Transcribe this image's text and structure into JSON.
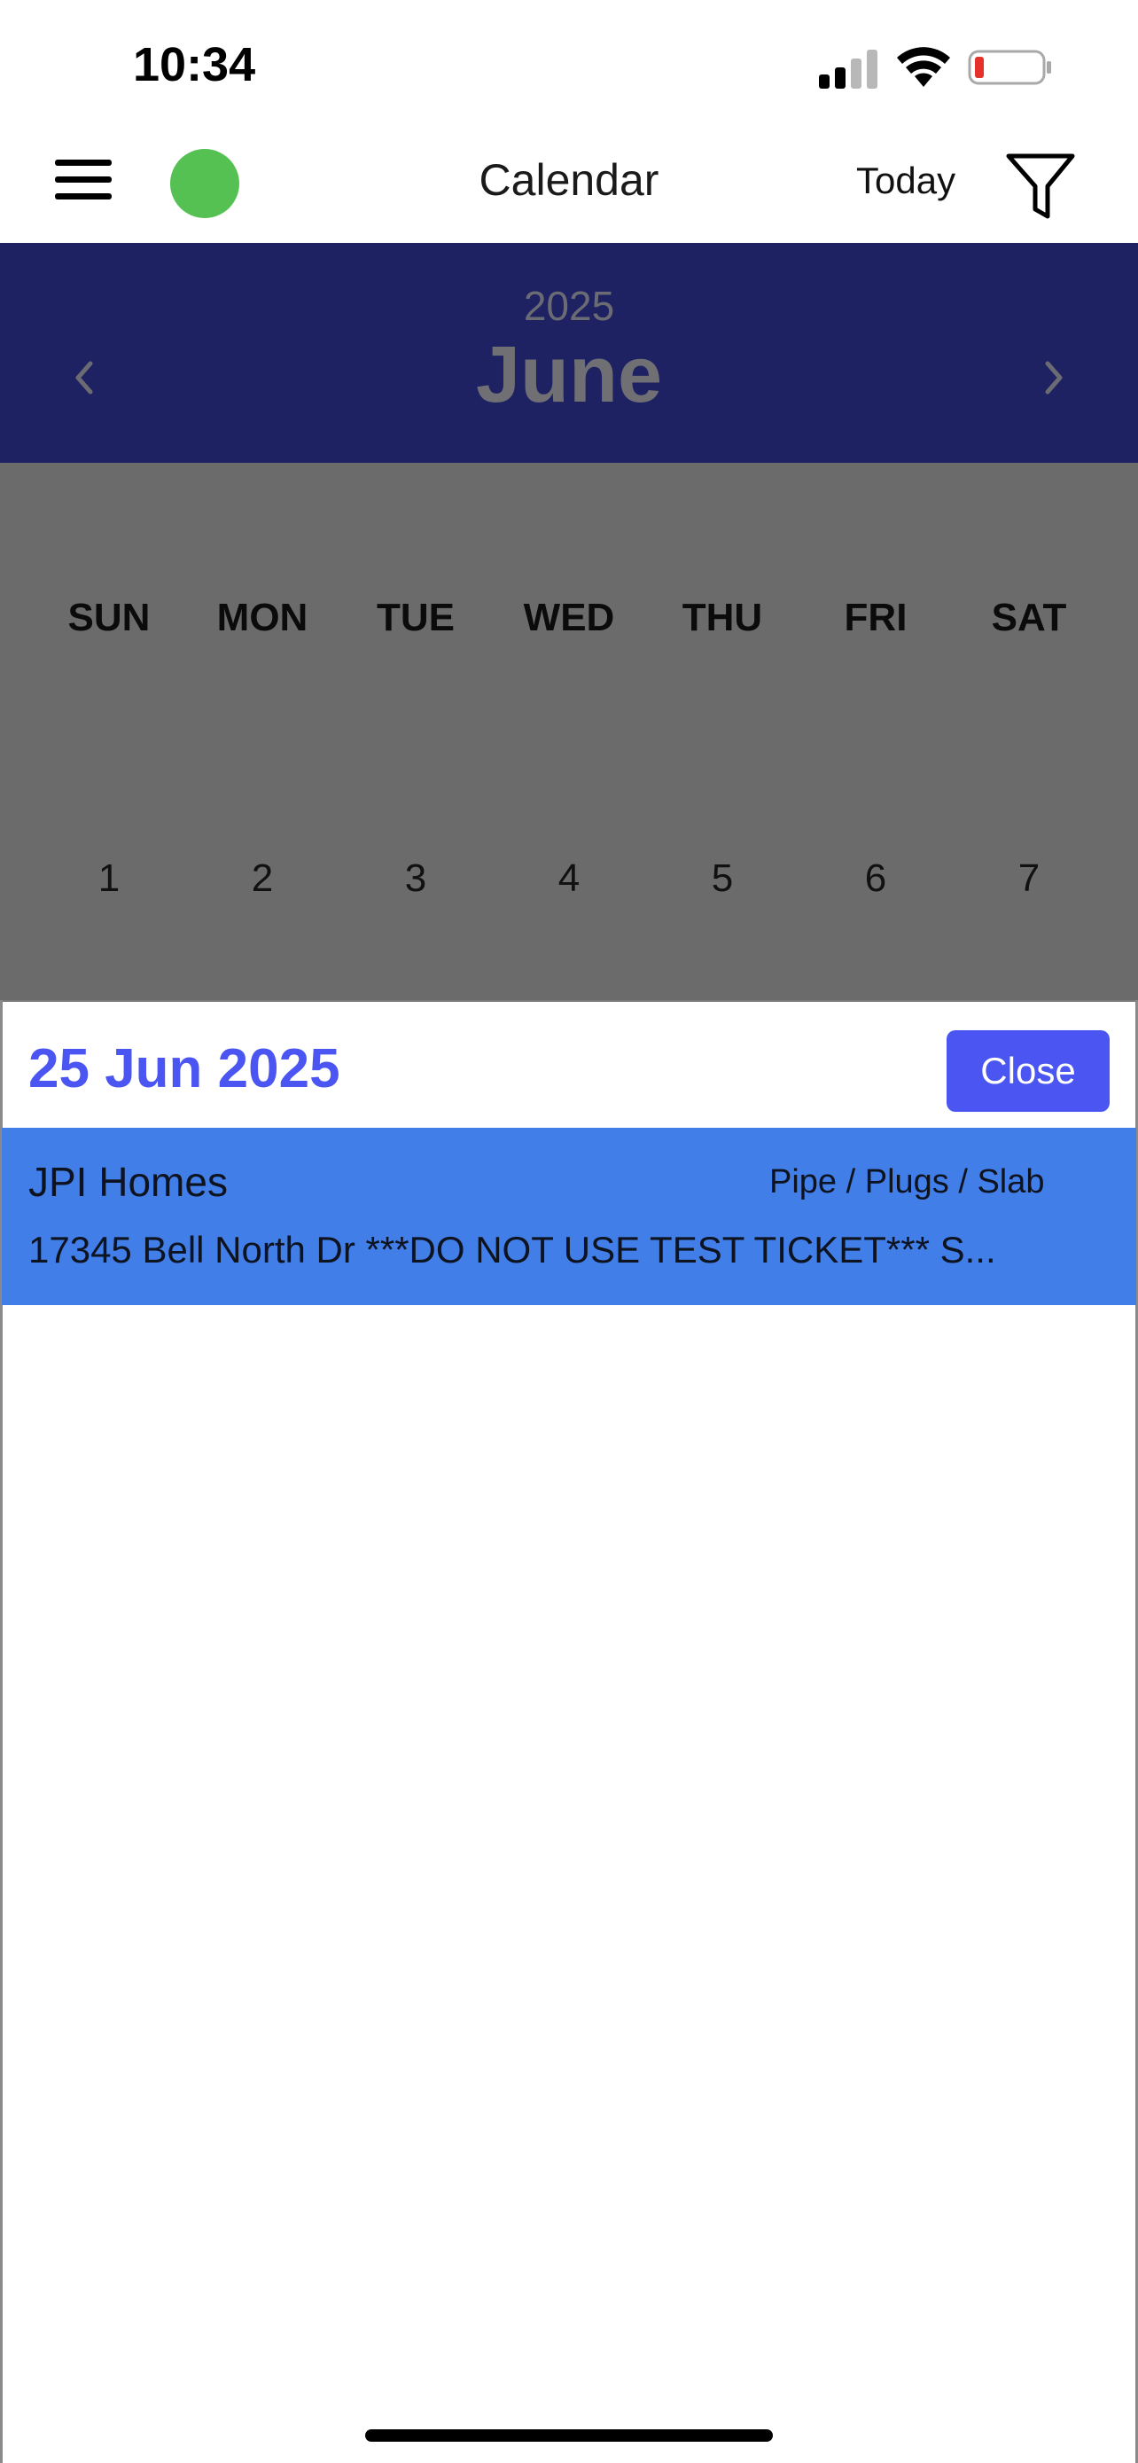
{
  "status_bar": {
    "time": "10:34"
  },
  "header": {
    "title": "Calendar",
    "today_label": "Today"
  },
  "calendar": {
    "year": "2025",
    "month": "June",
    "weekdays": [
      "SUN",
      "MON",
      "TUE",
      "WED",
      "THU",
      "FRI",
      "SAT"
    ],
    "days": [
      "1",
      "2",
      "3",
      "4",
      "5",
      "6",
      "7"
    ]
  },
  "sheet": {
    "date": "25 Jun 2025",
    "close_label": "Close",
    "events": [
      {
        "customer": "JPI Homes",
        "category": "Pipe / Plugs / Slab",
        "address": "17345 Bell North Dr ***DO NOT USE TEST TICKET*** S..."
      }
    ]
  },
  "colors": {
    "banner": "#1e2262",
    "accent": "#4b56f2",
    "event_card": "#417ee8",
    "status_dot": "#54c152",
    "overlay": "#6b6b6b"
  }
}
